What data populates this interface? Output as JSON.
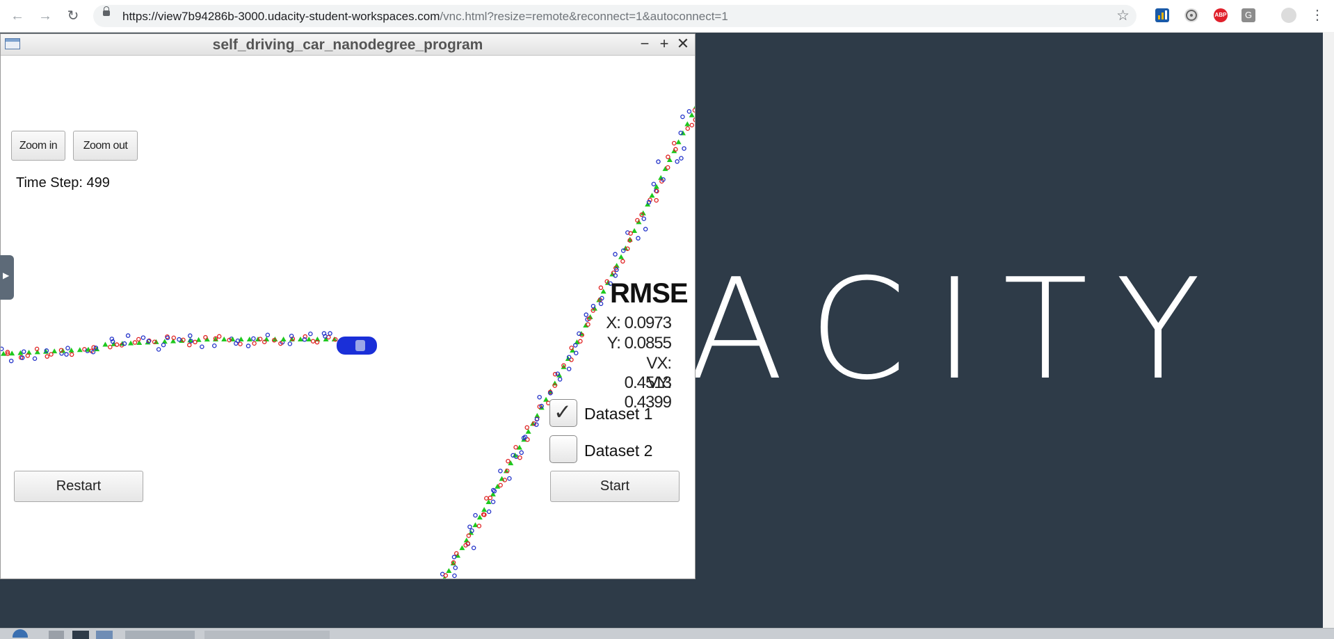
{
  "browser": {
    "url_host": "https://view7b94286b-3000.udacity-student-workspaces.com",
    "url_rest": "/vnc.html?resize=remote&reconnect=1&autoconnect=1",
    "back_icon": "arrow-left-icon",
    "forward_icon": "arrow-right-icon",
    "reload_icon": "reload-icon",
    "abp_label": "ABP",
    "g_label": "G"
  },
  "background": {
    "wordmark": "ACITY"
  },
  "window": {
    "title": "self_driving_car_nanodegree_program",
    "minimize": "−",
    "maximize": "+",
    "close": "✕"
  },
  "sim": {
    "zoom_in": "Zoom in",
    "zoom_out": "Zoom out",
    "time_step": "Time Step: 499",
    "rmse_title": "RMSE",
    "rmse": [
      {
        "label": "X: 0.0973"
      },
      {
        "label": "Y: 0.0855"
      },
      {
        "label": "VX: 0.4513"
      },
      {
        "label": "VY: 0.4399"
      }
    ],
    "dataset1": "Dataset 1",
    "dataset1_checked": true,
    "dataset2": "Dataset 2",
    "dataset2_checked": false,
    "restart": "Restart",
    "start": "Start"
  },
  "colors": {
    "lidar": "#e02020",
    "radar": "#2030c8",
    "estimate": "#1ec81e",
    "car": "#1a2fd8",
    "workspace_bg": "#2e3b48"
  }
}
